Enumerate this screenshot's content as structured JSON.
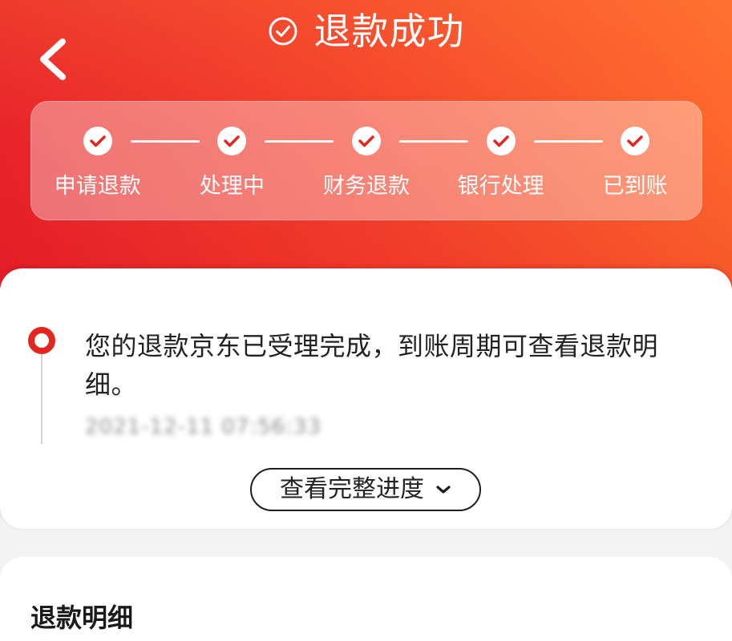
{
  "theme": {
    "brand_red": "#e4261e",
    "hero_gradient_start": "#e6202a",
    "hero_gradient_mid": "#f3402b",
    "hero_gradient_end": "#ff6c2d",
    "page_background": "#f3f3f3",
    "text_primary": "#222222",
    "text_muted": "#9a9a9a"
  },
  "header": {
    "back_icon": "chevron-left-icon",
    "title_icon": "check-circle-icon",
    "title": "退款成功"
  },
  "progress": {
    "step_icon": "check-icon",
    "steps": [
      {
        "label": "申请退款",
        "completed": true
      },
      {
        "label": "处理中",
        "completed": true
      },
      {
        "label": "财务退款",
        "completed": true
      },
      {
        "label": "银行处理",
        "completed": true
      },
      {
        "label": "已到账",
        "completed": true
      }
    ]
  },
  "status_card": {
    "marker_icon": "timeline-dot-icon",
    "message": "您的退款京东已受理完成，到账周期可查看退款明细。",
    "timestamp": "2021-12-11 07:56:33",
    "timestamp_blurred": true,
    "expand_button": {
      "label": "查看完整进度",
      "icon": "chevron-down-icon"
    }
  },
  "refund_detail": {
    "title": "退款明细"
  }
}
